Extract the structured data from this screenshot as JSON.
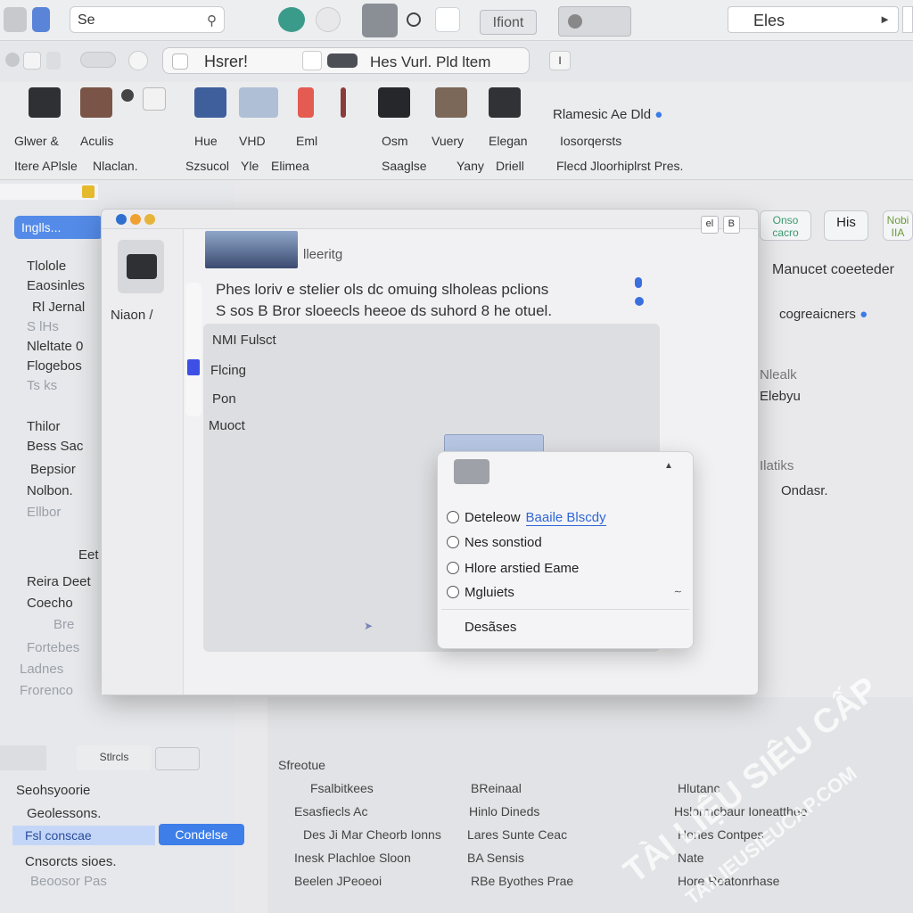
{
  "topbar": {
    "search_value": "Se",
    "center_button": "Ifiont",
    "right_field_value": "Eles"
  },
  "tabbar": {
    "tab_title": "Hsrer!",
    "tab_title_b": "Hes Vurl.",
    "tab_title_c": "Pld ltem",
    "extra": "I"
  },
  "ribbon": {
    "labels_row1": [
      "Glwer &",
      "Aculis",
      "Hue",
      "VHD",
      "Eml",
      "Osm",
      "Vuery",
      "Elegan"
    ],
    "labels_row2": [
      "Itere APlsle",
      "Nlaclan.",
      "Szsucol",
      "Yle",
      "Elimea",
      "Saaglse",
      "Yany",
      "Driell"
    ],
    "right_heading": "Rlamesic Ae Dld",
    "right_sub1": "Iosorqersts",
    "right_sub2": "Flecd Jloorhiplrst Pres."
  },
  "sidebar": {
    "selected_item": "Inglls...",
    "items": [
      "Tlolole",
      "Eaosinles",
      "Rl Jernal",
      "S lHs",
      "Nleltate 0",
      "Flogebos",
      "Ts ks",
      "Thilor",
      "Bess Sac",
      "Bepsior",
      "Nolbon.",
      "Ellbor",
      "Eet",
      "Reira Deet",
      "Coecho",
      "Bre",
      "Fortebes",
      "Ladnes",
      "Frorenco"
    ],
    "bottom_tab": "Stlrcls",
    "bottom_items": [
      "Seohsyoorie",
      "Geolessons.",
      "Fsl conscae",
      "Cnsorcts sioes.",
      "Beoosor Pas"
    ],
    "bottom_selected": "Condelse"
  },
  "dialog": {
    "left_label": "Niaon /",
    "header_img_caption": "lleeritg",
    "text_line1": "Phes loriv e stelier ols dc omuing slholeas pclions",
    "text_line2": "S sos B Bror sloeecls heeoe ds suhord 8 he otuel.",
    "options": [
      "NMI Fulsct",
      "Flcing",
      "Pon",
      "Muoct"
    ],
    "btn_small_1": "el",
    "btn_small_2": "B"
  },
  "popover": {
    "items": [
      {
        "label": "Deteleow",
        "link": "Baaile Blscdy"
      },
      {
        "label": "Nes sonstiod",
        "link": ""
      },
      {
        "label": "Hlore arstied Eame",
        "link": ""
      },
      {
        "label": "Mgluiets",
        "link": ""
      }
    ],
    "footer": "Desãses"
  },
  "rightpanel": {
    "btn1": "Onso cacro",
    "btn2": "His",
    "btn3": "Nobi IIA",
    "heading": "Manucet coeeteder",
    "line2": "cogreaicners",
    "items": [
      "Nlealk",
      "Elebyu",
      "Ilatiks",
      "Ondasr."
    ]
  },
  "bottom": {
    "header": "Sfreotue",
    "rows": [
      [
        "Fsalbitkees",
        "BReinaal",
        "Hlutanc"
      ],
      [
        "Esasfiecls Ac",
        "Hinlo Dineds",
        "Hslormcbaur Ioneatthee"
      ],
      [
        "Des Ji Mar Cheorb Ionns",
        "Lares Sunte Ceac",
        "Hones Contpes"
      ],
      [
        "Inesk Plachloe Sloon",
        "BA Sensis",
        "Nate"
      ],
      [
        "Beelen JPeoeoi",
        "RBe Byothes Prae",
        "Hore Reatonrhase"
      ]
    ]
  },
  "watermark": {
    "line1": "TÀI LIỆU SIÊU CẤP",
    "line2": "TAILIEUSIEUCAP.COM"
  },
  "colors": {
    "accent": "#3b7be8",
    "link": "#2f66d6",
    "traffic_red": "#f0a030",
    "traffic_yellow": "#e6b43a",
    "traffic_green": "#2f6fd0"
  }
}
